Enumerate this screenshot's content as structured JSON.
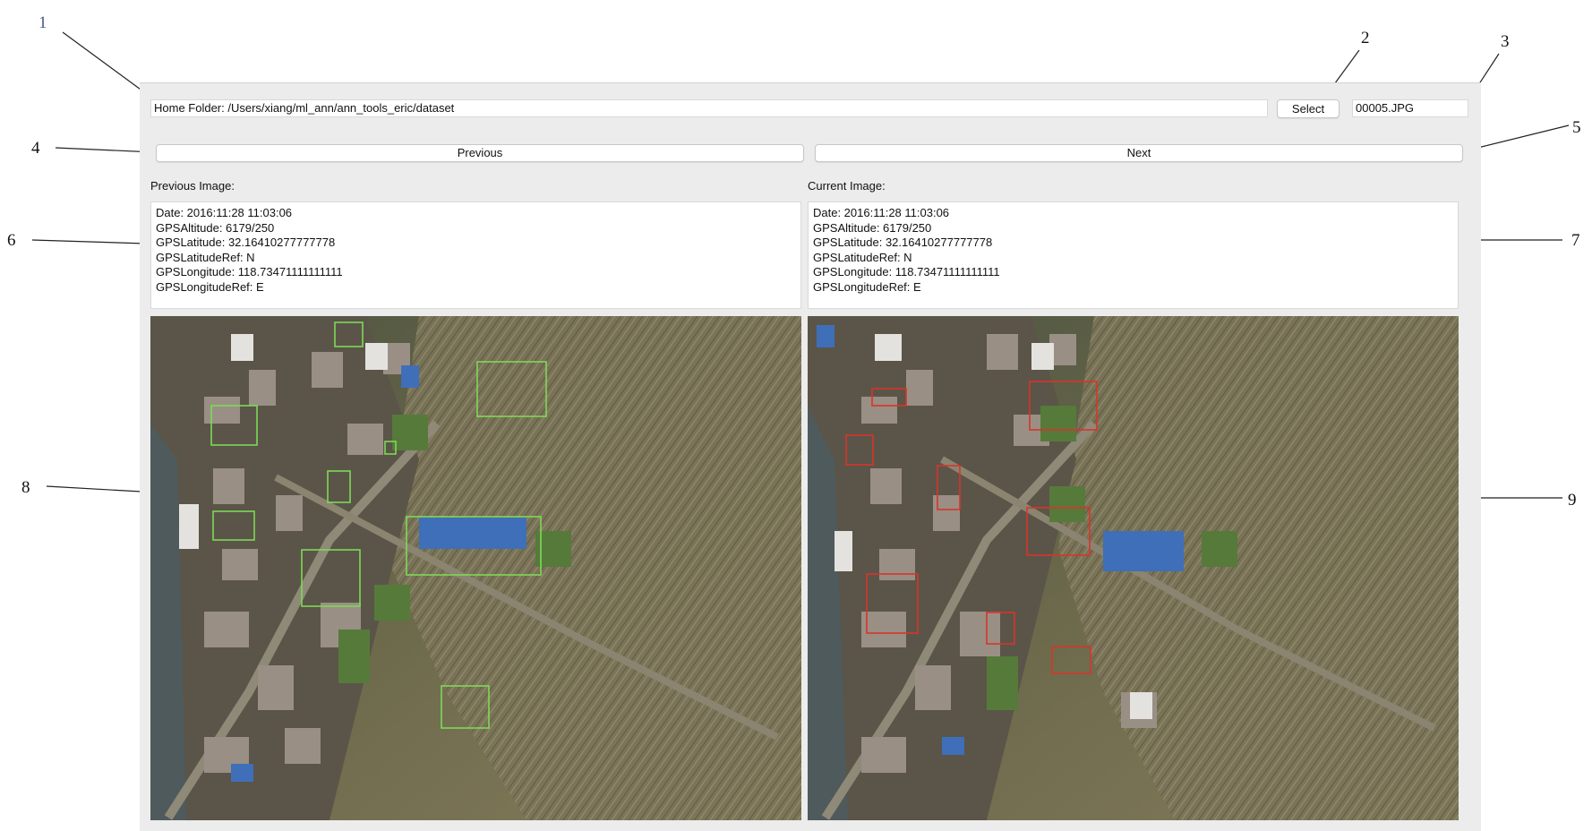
{
  "callouts": [
    "1",
    "2",
    "3",
    "4",
    "5",
    "6",
    "7",
    "8",
    "9"
  ],
  "toolbar": {
    "home_folder": "Home Folder: /Users/xiang/ml_ann/ann_tools_eric/dataset",
    "select_label": "Select",
    "file_name": "00005.JPG"
  },
  "nav": {
    "previous_label": "Previous",
    "next_label": "Next"
  },
  "previous_image": {
    "title": "Previous Image:",
    "info": [
      "Date: 2016:11:28 11:03:06",
      "GPSAltitude: 6179/250",
      "GPSLatitude: 32.16410277777778",
      "GPSLatitudeRef: N",
      "GPSLongitude: 118.73471111111111",
      "GPSLongitudeRef: E"
    ],
    "box_color": "#7ed957"
  },
  "current_image": {
    "title": "Current Image:",
    "info": [
      "Date: 2016:11:28 11:03:06",
      "GPSAltitude: 6179/250",
      "GPSLatitude: 32.16410277777778",
      "GPSLatitudeRef: N",
      "GPSLongitude: 118.73471111111111",
      "GPSLongitudeRef: E"
    ],
    "box_color": "#d9342b"
  }
}
